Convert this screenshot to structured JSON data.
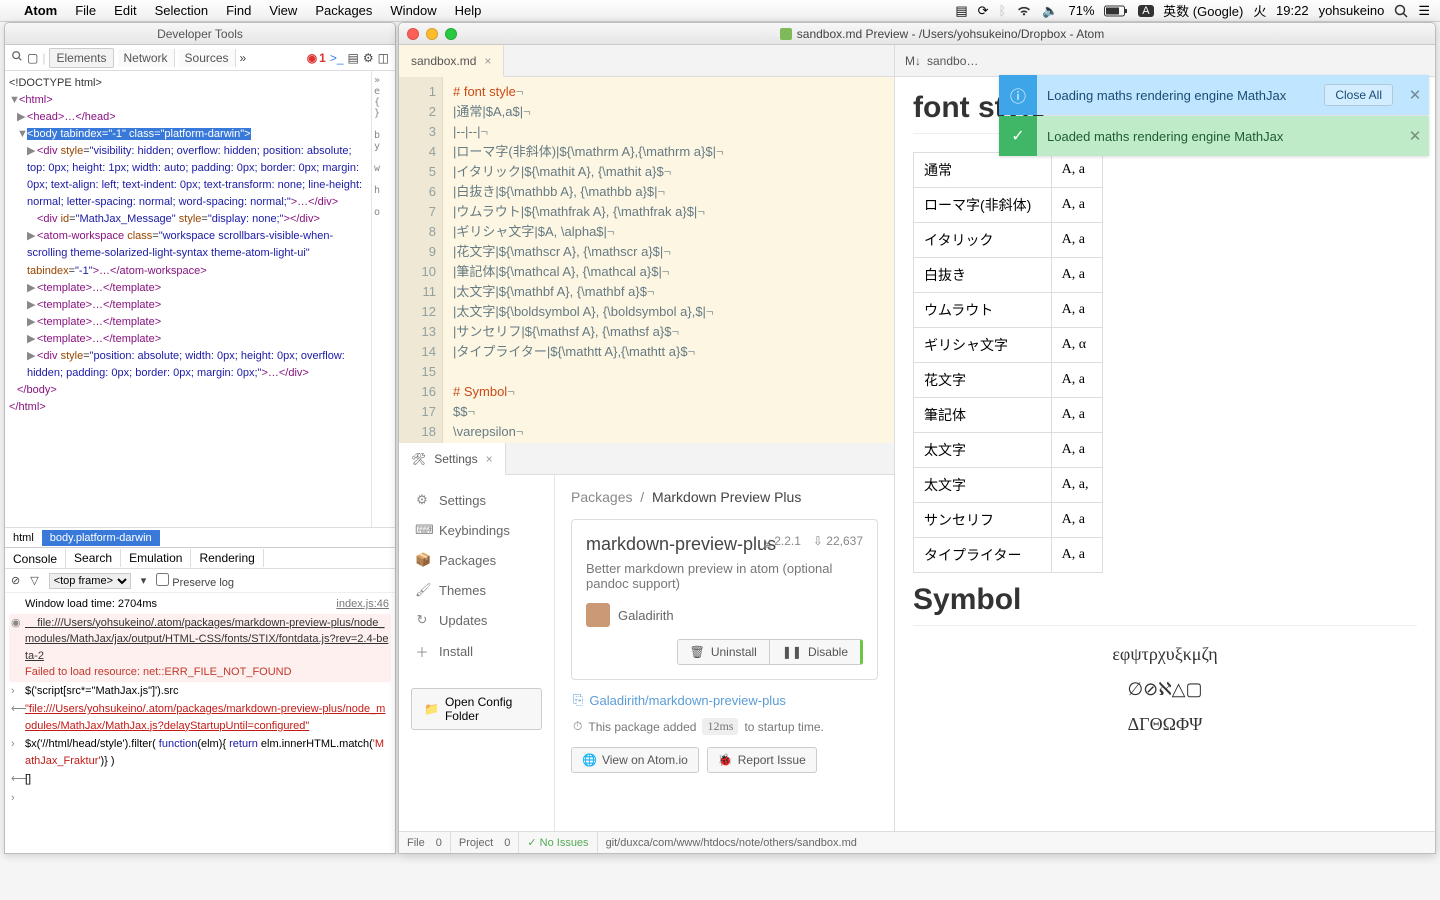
{
  "menubar": {
    "app": "Atom",
    "items": [
      "File",
      "Edit",
      "Selection",
      "Find",
      "View",
      "Packages",
      "Window",
      "Help"
    ],
    "battery": "71%",
    "ime_badge": "A",
    "ime": "英数 (Google)",
    "day": "火",
    "time": "19:22",
    "user": "yohsukeino"
  },
  "devtools": {
    "title": "Developer Tools",
    "tabs": [
      "Elements",
      "Network",
      "Sources"
    ],
    "error_count": "1",
    "dom": {
      "doctype": "<!DOCTYPE html>",
      "html_open": "<html>",
      "head": "<head>…</head>",
      "body_open_pre": "<body ",
      "body_attr1": "tabindex=\"-1\" ",
      "body_attr2": "class=\"platform-darwin\"",
      "body_open_post": ">",
      "div1": "<div style=\"visibility: hidden; overflow: hidden; position: absolute; top: 0px; height: 1px; width: auto; padding: 0px; border: 0px; margin: 0px; text-align: left; text-indent: 0px; text-transform: none; line-height: normal; letter-spacing: normal; word-spacing: normal;\">…</div>",
      "div2": "  <div id=\"MathJax_Message\" style=\"display: none;\"></div>",
      "aw": "<atom-workspace class=\"workspace scrollbars-visible-when-scrolling theme-solarized-light-syntax theme-atom-light-ui\" tabindex=\"-1\">…</atom-workspace>",
      "t1": "<template>…</template>",
      "t2": "<template>…</template>",
      "t3": "<template>…</template>",
      "t4": "<template>…</template>",
      "div3": "<div style=\"position: absolute; width: 0px; height: 0px; overflow: hidden; padding: 0px; border: 0px; margin: 0px;\">…</div>",
      "body_close": "</body>",
      "html_close": "</html>"
    },
    "styles_hint": "eleme { } body { f… } wid… hei… ove…",
    "breadcrumb": [
      "html",
      "body.platform-darwin"
    ],
    "console_tabs": [
      "Console",
      "Search",
      "Emulation",
      "Rendering"
    ],
    "frame": "<top frame>",
    "preserve": "Preserve log",
    "console": {
      "load": "Window load time: 2704ms",
      "load_src": "index.js:46",
      "err1a": "    file:///Users/yohsukeino/.atom/packages/markdown-preview-plus/node_modules/MathJax/jax/output/HTML-CSS/fonts/STIX/fontdata.js?rev=2.4-beta-2",
      "err1b": "Failed to load resource: net::ERR_FILE_NOT_FOUND",
      "l2": "$('script[src*=\"MathJax.js\"]').src",
      "l3": "\"file:///Users/yohsukeino/.atom/packages/markdown-preview-plus/node_modules/MathJax/MathJax.js?delayStartupUntil=configured\"",
      "l4a": "$x('//html/head/style').filter( ",
      "l4b": "function",
      "l4c": "(elm){ ",
      "l4d": "return",
      "l4e": " elm.innerHTML.match(",
      "l4f": "'MathJax_Fraktur'",
      "l4g": ")} )",
      "l5": "[]"
    }
  },
  "atom": {
    "title": "sandbox.md Preview - /Users/yohsukeino/Dropbox - Atom",
    "editor_tab": "sandbox.md",
    "code_lines": [
      "# font style",
      "|通常|$A,a$|",
      "|--|--|",
      "|ローマ字(非斜体)|${\\mathrm A},{\\mathrm a}$|",
      "|イタリック|${\\mathit A}, {\\mathit a}$",
      "|白抜き|${\\mathbb A}, {\\mathbb a}$|",
      "|ウムラウト|${\\mathfrak A}, {\\mathfrak a}$|",
      "|ギリシャ文字|$A, \\alpha$|",
      "|花文字|${\\mathscr A}, {\\mathscr a}$|",
      "|筆記体|${\\mathcal A}, {\\mathcal a}$|",
      "|太文字|${\\mathbf A}, {\\mathbf a}$",
      "|太文字|${\\boldsymbol A}, {\\boldsymbol a},$|",
      "|サンセリフ|${\\mathsf A}, {\\mathsf a}$",
      "|タイプライター|${\\mathtt A},{\\mathtt a}$",
      "",
      "# Symbol",
      "$$",
      "\\varepsilon"
    ],
    "settings_tab": "Settings",
    "nav": {
      "settings": "Settings",
      "keyb": "Keybindings",
      "pkg": "Packages",
      "themes": "Themes",
      "updates": "Updates",
      "install": "Install",
      "cfg": "Open Config Folder"
    },
    "bcrumb": {
      "root": "Packages",
      "sep": "/",
      "cur": "Markdown Preview Plus"
    },
    "pkg": {
      "name": "markdown-preview-plus",
      "ver": "2.2.1",
      "dl": "22,637",
      "desc": "Better markdown preview in atom (optional pandoc support)",
      "author": "Galadirith",
      "uninstall": "Uninstall",
      "disable": "Disable",
      "repo": "Galadirith/markdown-preview-plus",
      "startup_a": "This package added ",
      "startup_ms": "12ms",
      "startup_b": " to startup time.",
      "view": "View on Atom.io",
      "report": "Report Issue"
    },
    "notif": {
      "info": "Loading maths rendering engine MathJax",
      "info_btn": "Close All",
      "succ": "Loaded maths rendering engine MathJax"
    },
    "preview": {
      "tab": "sandbo…",
      "h1a": "font style",
      "h1b": "Symbol",
      "rows": [
        [
          "通常",
          "A, a"
        ],
        [
          "ローマ字(非斜体)",
          "A, a"
        ],
        [
          "イタリック",
          "A, a"
        ],
        [
          "白抜き",
          "A, a"
        ],
        [
          "ウムラウト",
          "A, a"
        ],
        [
          "ギリシャ文字",
          "A, α"
        ],
        [
          "花文字",
          "A, a"
        ],
        [
          "筆記体",
          "A, a"
        ],
        [
          "太文字",
          "A, a"
        ],
        [
          "太文字",
          "A, a,"
        ],
        [
          "サンセリフ",
          "A, a"
        ],
        [
          "タイプライター",
          "A, a"
        ]
      ],
      "sym1": "εφψτρχυξκμζη",
      "sym2": "∅⊘ℵ△▢",
      "sym3": "ΔΓΘΩΦΨ"
    },
    "status": {
      "file": "File",
      "file_n": "0",
      "proj": "Project",
      "proj_n": "0",
      "ok": "No Issues",
      "path": "git/duxca/com/www/htdocs/note/others/sandbox.md"
    }
  }
}
